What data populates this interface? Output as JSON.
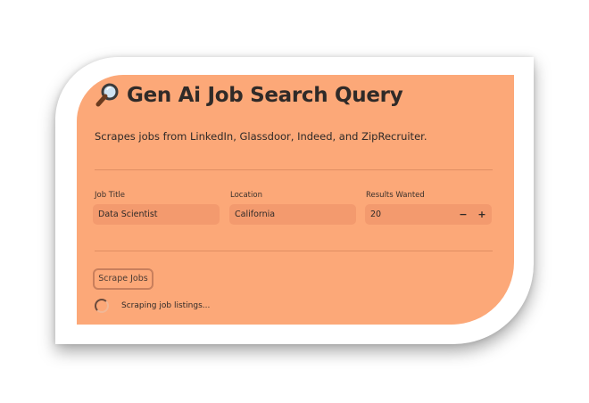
{
  "app": {
    "title": "Gen Ai Job Search Query",
    "subtitle": "Scrapes jobs from LinkedIn, Glassdoor, Indeed, and ZipRecruiter.",
    "title_icon": "magnifying-glass-icon"
  },
  "form": {
    "job_title": {
      "label": "Job Title",
      "value": "Data Scientist"
    },
    "location": {
      "label": "Location",
      "value": "California"
    },
    "results_wanted": {
      "label": "Results Wanted",
      "value": "20",
      "decrement": "−",
      "increment": "+"
    }
  },
  "actions": {
    "scrape_label": "Scrape Jobs"
  },
  "status": {
    "text": "Scraping job listings..."
  },
  "colors": {
    "panel_background": "#fca878",
    "input_background": "#f39a6e",
    "text": "#2f2a28"
  }
}
